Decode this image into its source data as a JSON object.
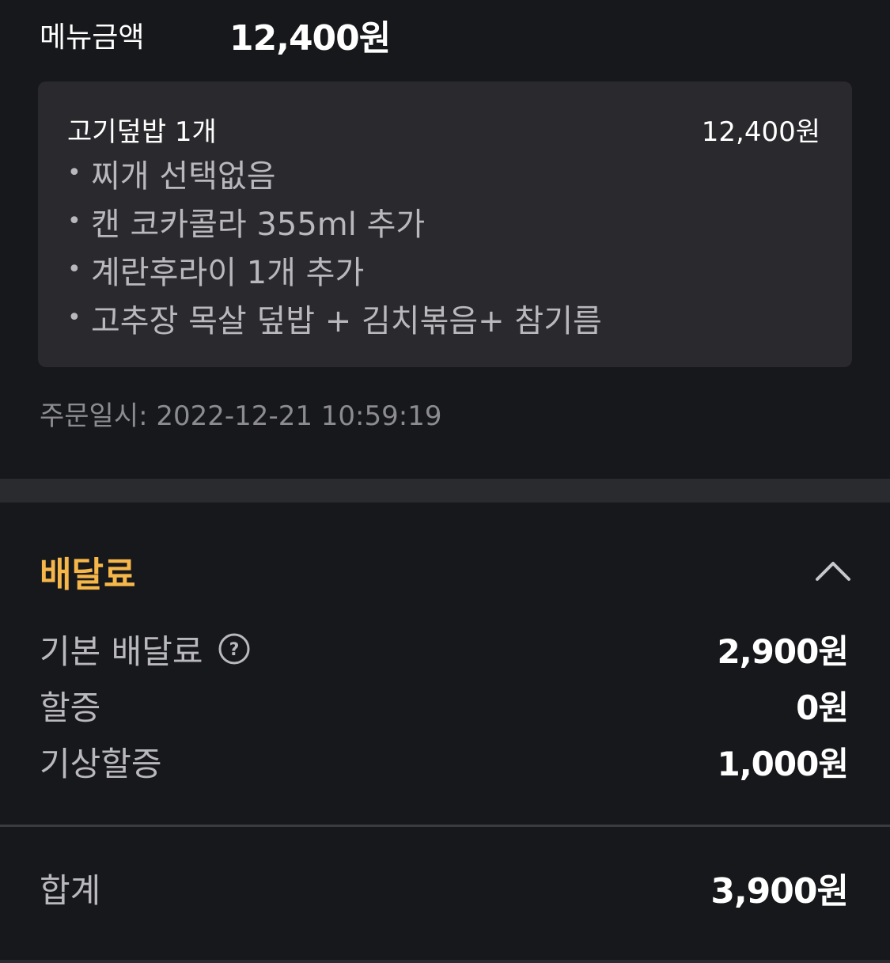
{
  "menu_amount": {
    "label": "메뉴금액",
    "value": "12,400원"
  },
  "order_item": {
    "name": "고기덮밥 1개",
    "price": "12,400원",
    "options": [
      "찌개 선택없음",
      "캔 코카콜라 355ml  추가",
      "계란후라이 1개 추가",
      "고추장 목살 덮밥 + 김치볶음+ 참기름"
    ]
  },
  "order_time": "주문일시: 2022-12-21 10:59:19",
  "delivery_fee": {
    "title": "배달료",
    "rows": [
      {
        "label": "기본 배달료",
        "value": "2,900원"
      },
      {
        "label": "할증",
        "value": "0원"
      },
      {
        "label": "기상할증",
        "value": "1,000원"
      }
    ]
  },
  "total": {
    "label": "합계",
    "value": "3,900원"
  },
  "colors": {
    "background": "#17181b",
    "card": "#2a2a2e",
    "accent": "#f5b74a",
    "muted_text": "#b9b9bd"
  },
  "icons": {
    "collapse": "chevron-up-icon",
    "help": "question-circle-icon"
  }
}
